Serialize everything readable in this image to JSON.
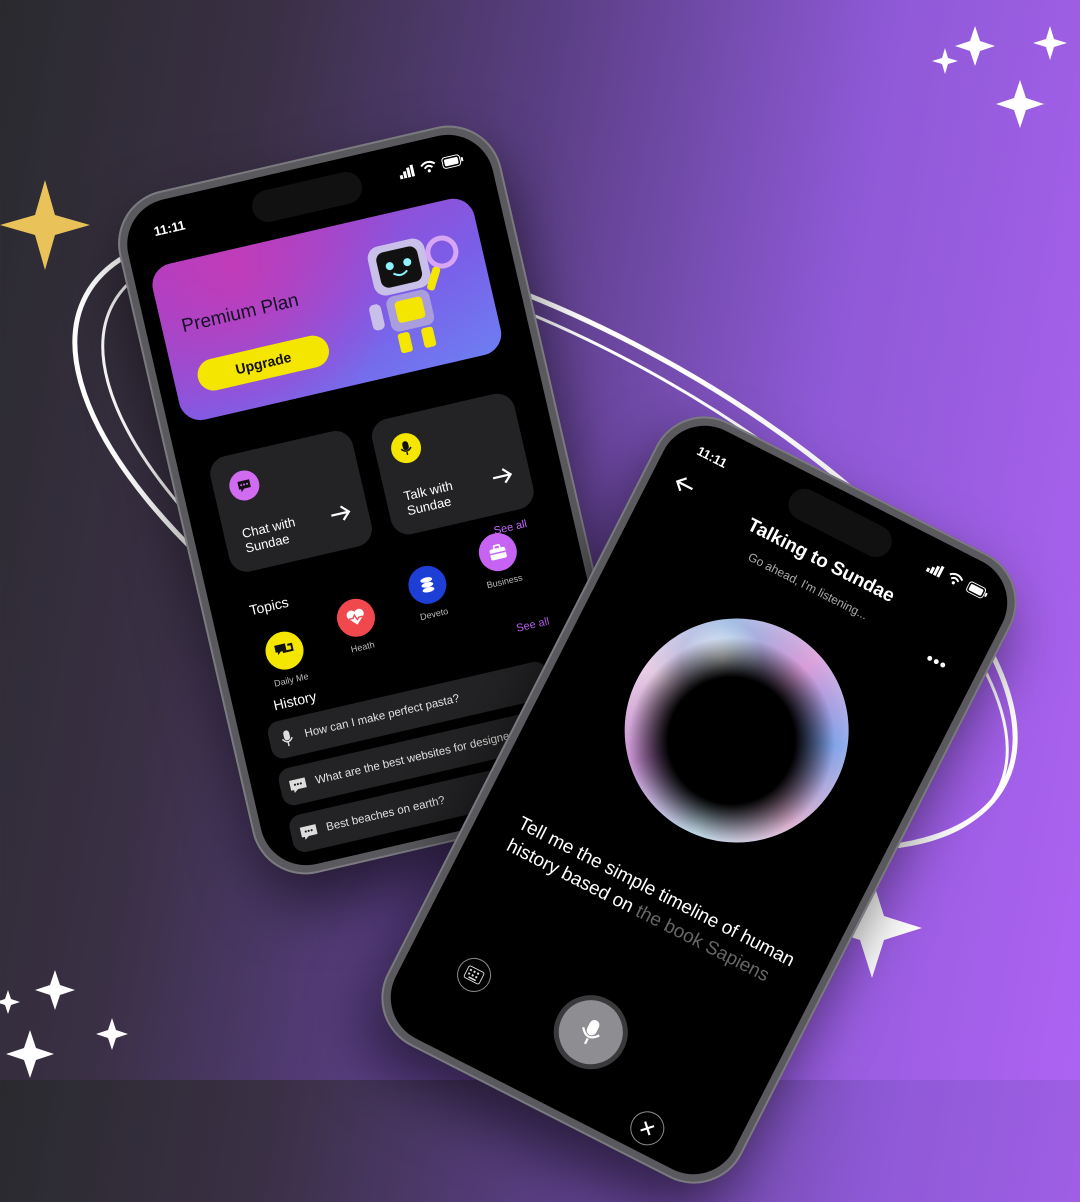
{
  "phone1": {
    "status": {
      "time": "11:11"
    },
    "premium": {
      "title": "Premium Plan",
      "button": "Upgrade"
    },
    "cards": [
      {
        "label_line1": "Chat with",
        "label_line2": "Sundae",
        "icon": "chat-bubble-icon",
        "color": "#d16cf0"
      },
      {
        "label_line1": "Talk with",
        "label_line2": "Sundae",
        "icon": "microphone-icon",
        "color": "#f5e600"
      }
    ],
    "see_all_1": "See all",
    "topics": {
      "title": "Topics",
      "see_all": "See all",
      "items": [
        {
          "label": "Daily Me",
          "icon": "chat-bubbles-icon",
          "color": "#f5e600"
        },
        {
          "label": "Heath",
          "icon": "heart-pulse-icon",
          "color": "#f0484c"
        },
        {
          "label": "Deveto",
          "icon": "coins-icon",
          "color": "#1d3fd6"
        },
        {
          "label": "Business",
          "icon": "briefcase-icon",
          "color": "#c663f2"
        }
      ]
    },
    "history": {
      "title": "History",
      "items": [
        {
          "text": "How can I make perfect pasta?",
          "icon": "microphone-icon"
        },
        {
          "text": "What are the best websites for designers",
          "icon": "chat-bubble-icon"
        },
        {
          "text": "Best beaches on earth?",
          "icon": "chat-bubble-icon"
        }
      ]
    }
  },
  "phone2": {
    "status": {
      "time": "11:11"
    },
    "title": "Talking to Sundae",
    "subtitle": "Go ahead, I'm listening...",
    "prompt_bright": "Tell me the simple timeline of human history based on",
    "prompt_dim": "the book Sapiens",
    "menu": "•••"
  },
  "colors": {
    "accent_purple": "#c468ff",
    "accent_yellow": "#f5e600",
    "card_bg": "#232325"
  }
}
